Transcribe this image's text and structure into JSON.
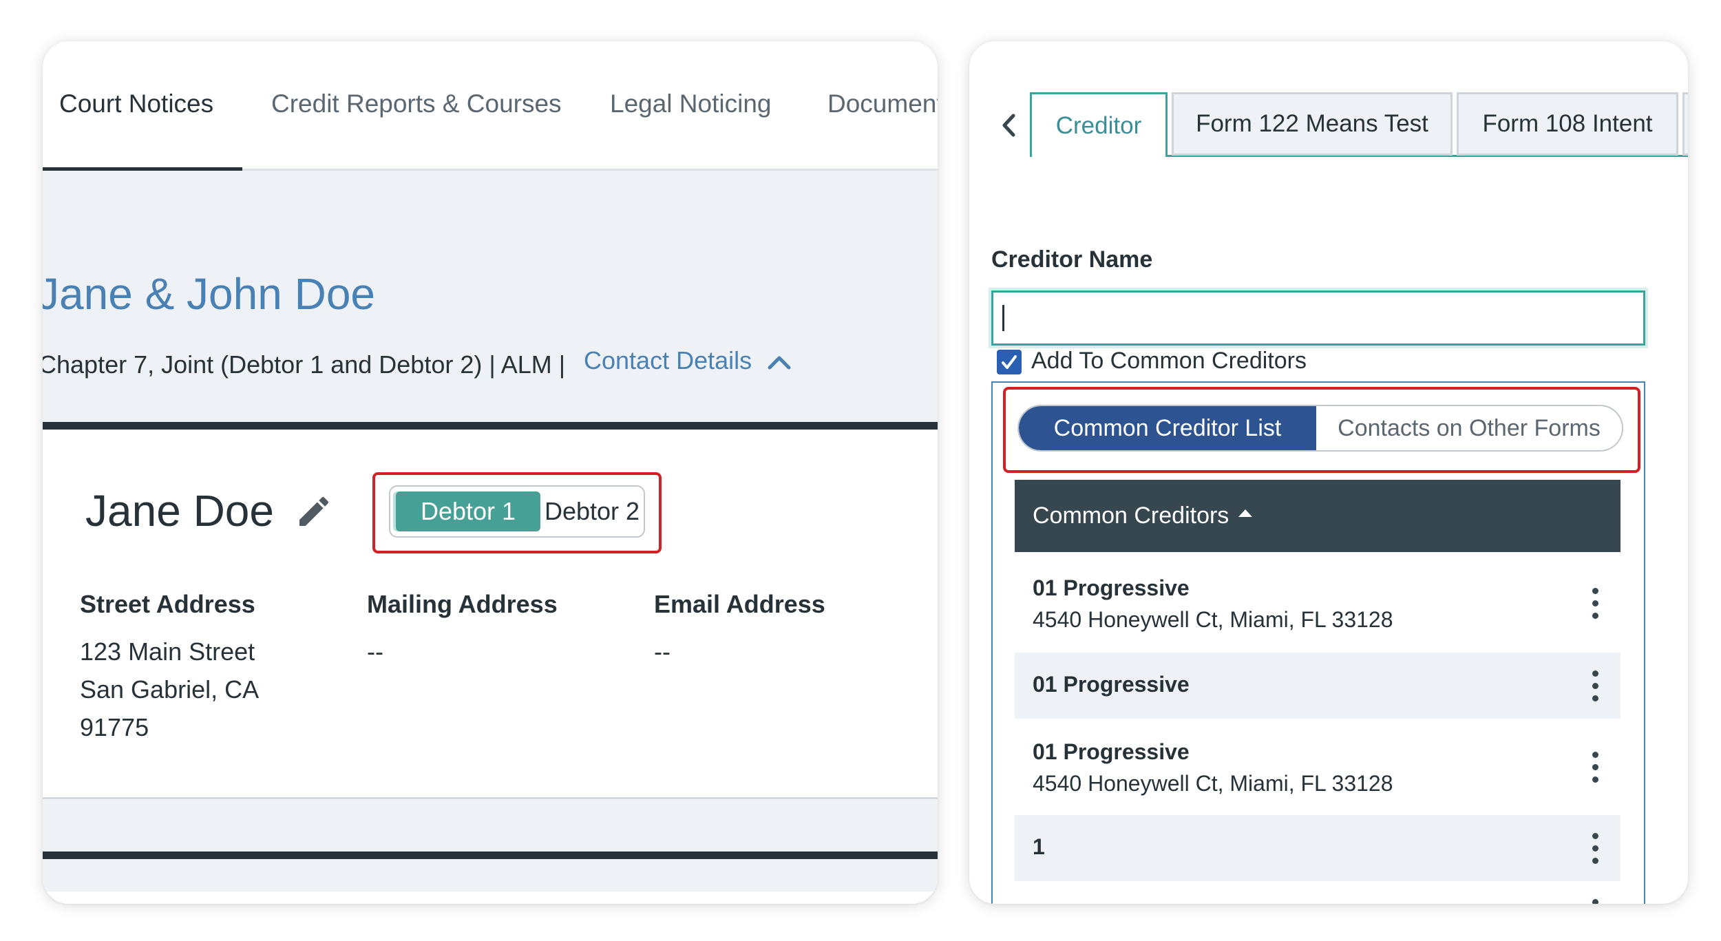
{
  "left_panel": {
    "tabs": [
      {
        "label": "Court Notices",
        "active": true
      },
      {
        "label": "Credit Reports & Courses",
        "active": false
      },
      {
        "label": "Legal Noticing",
        "active": false
      },
      {
        "label": "Document",
        "active": false
      }
    ],
    "case": {
      "title": "Jane & John Doe",
      "meta": "Chapter 7, Joint (Debtor 1 and Debtor 2) | ALM |",
      "contact_link": "Contact Details"
    },
    "debtor": {
      "name": "Jane Doe",
      "toggle": {
        "option_1": "Debtor 1",
        "option_2": "Debtor 2",
        "selected": "Debtor 1"
      },
      "address_columns": [
        {
          "heading": "Street Address",
          "lines": [
            "123 Main Street",
            "San Gabriel, CA",
            "91775"
          ]
        },
        {
          "heading": "Mailing Address",
          "lines": [
            "--"
          ]
        },
        {
          "heading": "Email Address",
          "lines": [
            "--"
          ]
        }
      ]
    }
  },
  "right_panel": {
    "tabs": [
      {
        "label": "Creditor",
        "active": true
      },
      {
        "label": "Form 122 Means Test",
        "active": false
      },
      {
        "label": "Form 108 Intent",
        "active": false
      }
    ],
    "creditor_name_label": "Creditor Name",
    "creditor_name_value": "",
    "add_to_common": {
      "label": "Add To Common Creditors",
      "checked": true
    },
    "list_toggle": {
      "option_1": "Common Creditor List",
      "option_2": "Contacts on Other Forms",
      "selected": "Common Creditor List"
    },
    "list_header": "Common Creditors",
    "creditors": [
      {
        "name": "01 Progressive",
        "address": "4540 Honeywell Ct, Miami, FL 33128"
      },
      {
        "name": "01 Progressive",
        "address": ""
      },
      {
        "name": "01 Progressive",
        "address": "4540 Honeywell Ct, Miami, FL 33128"
      },
      {
        "name": "1",
        "address": ""
      }
    ]
  },
  "colors": {
    "link_blue": "#4a81b5",
    "teal_accent": "#3aa39a",
    "toggle_teal": "#46a096",
    "toggle_navy": "#2d5490",
    "dark_slate": "#37474f",
    "highlight_red": "#d32027"
  }
}
